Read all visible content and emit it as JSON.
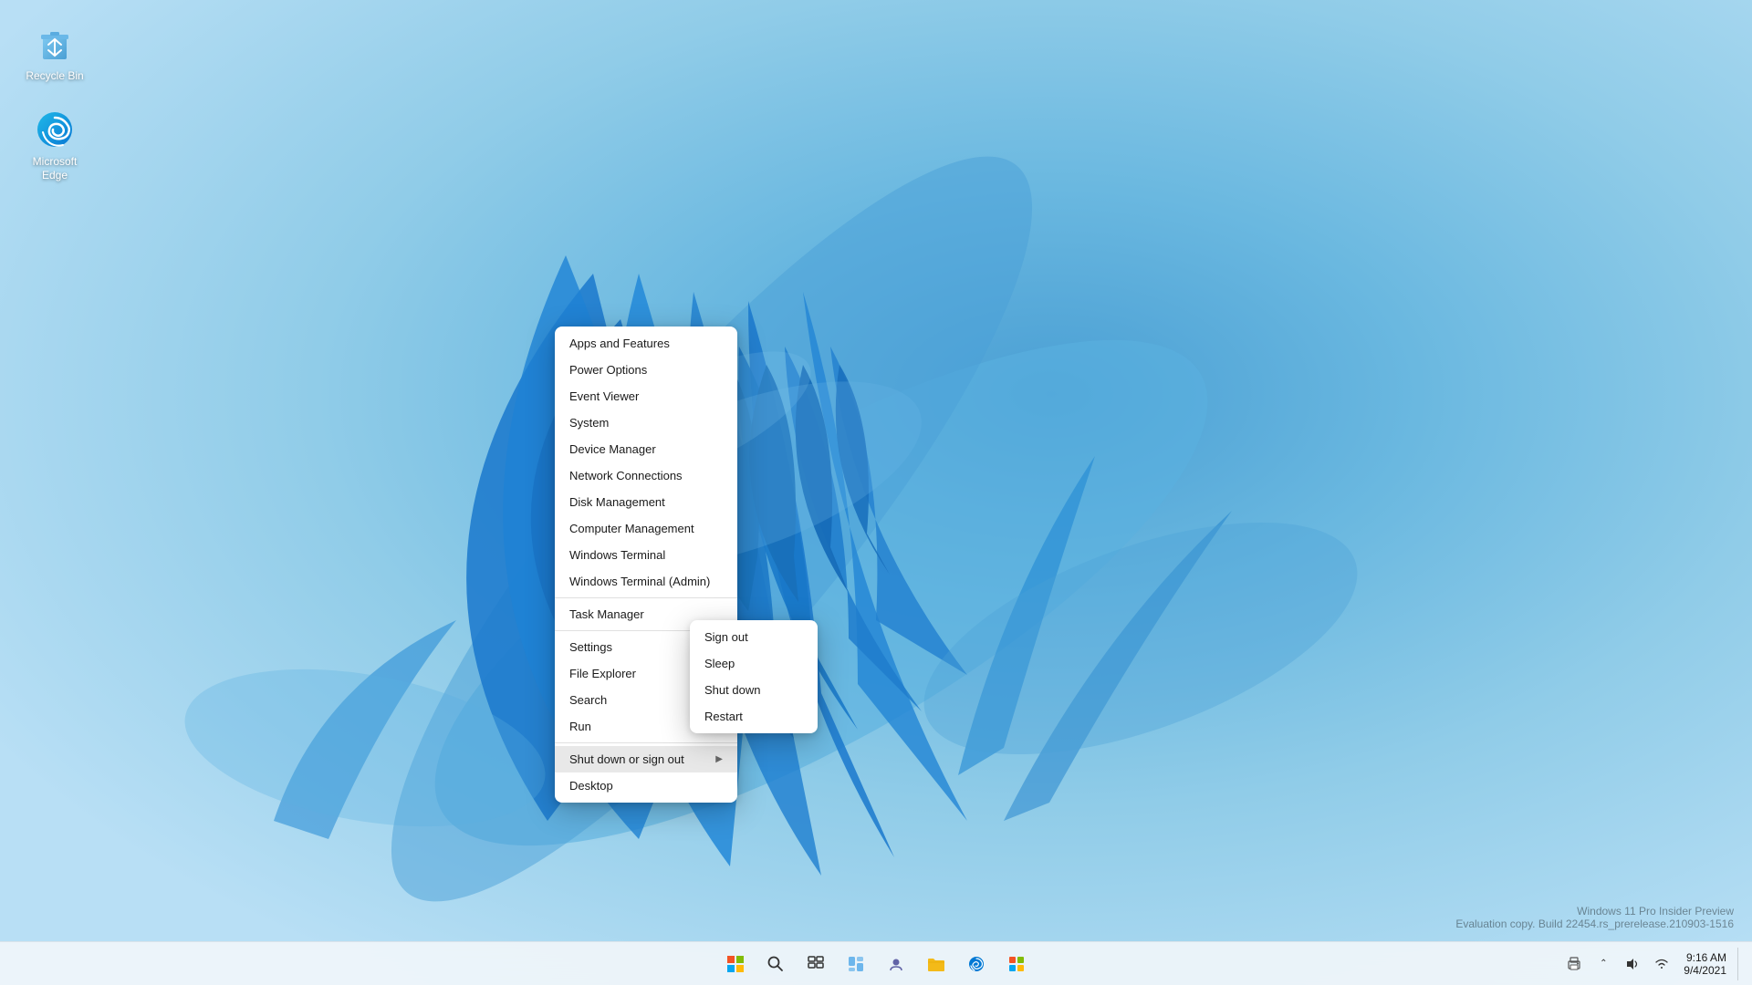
{
  "desktop": {
    "background_color": "#7ec8e8",
    "icons": [
      {
        "id": "recycle-bin",
        "label": "Recycle Bin",
        "icon": "recycle-bin"
      },
      {
        "id": "microsoft-edge",
        "label": "Microsoft Edge",
        "icon": "edge"
      }
    ]
  },
  "context_menu": {
    "items": [
      {
        "id": "apps-features",
        "label": "Apps and Features",
        "has_submenu": false
      },
      {
        "id": "power-options",
        "label": "Power Options",
        "has_submenu": false
      },
      {
        "id": "event-viewer",
        "label": "Event Viewer",
        "has_submenu": false
      },
      {
        "id": "system",
        "label": "System",
        "has_submenu": false
      },
      {
        "id": "device-manager",
        "label": "Device Manager",
        "has_submenu": false
      },
      {
        "id": "network-connections",
        "label": "Network Connections",
        "has_submenu": false
      },
      {
        "id": "disk-management",
        "label": "Disk Management",
        "has_submenu": false
      },
      {
        "id": "computer-management",
        "label": "Computer Management",
        "has_submenu": false
      },
      {
        "id": "windows-terminal",
        "label": "Windows Terminal",
        "has_submenu": false
      },
      {
        "id": "windows-terminal-admin",
        "label": "Windows Terminal (Admin)",
        "has_submenu": false
      },
      {
        "id": "task-manager",
        "label": "Task Manager",
        "has_submenu": false
      },
      {
        "id": "settings",
        "label": "Settings",
        "has_submenu": false
      },
      {
        "id": "file-explorer",
        "label": "File Explorer",
        "has_submenu": false
      },
      {
        "id": "search",
        "label": "Search",
        "has_submenu": false
      },
      {
        "id": "run",
        "label": "Run",
        "has_submenu": false
      },
      {
        "id": "shut-down-sign-out",
        "label": "Shut down or sign out",
        "has_submenu": true
      },
      {
        "id": "desktop",
        "label": "Desktop",
        "has_submenu": false
      }
    ]
  },
  "submenu": {
    "items": [
      {
        "id": "sign-out",
        "label": "Sign out"
      },
      {
        "id": "sleep",
        "label": "Sleep"
      },
      {
        "id": "shut-down",
        "label": "Shut down"
      },
      {
        "id": "restart",
        "label": "Restart"
      }
    ]
  },
  "taskbar": {
    "icons": [
      {
        "id": "start",
        "label": "Start",
        "unicode": "⊞"
      },
      {
        "id": "search",
        "label": "Search",
        "unicode": "🔍"
      },
      {
        "id": "task-view",
        "label": "Task View",
        "unicode": "⧉"
      },
      {
        "id": "widgets",
        "label": "Widgets",
        "unicode": "▦"
      },
      {
        "id": "chat",
        "label": "Chat",
        "unicode": "💬"
      },
      {
        "id": "file-explorer",
        "label": "File Explorer",
        "unicode": "📁"
      },
      {
        "id": "edge",
        "label": "Microsoft Edge",
        "unicode": "🌐"
      },
      {
        "id": "store",
        "label": "Microsoft Store",
        "unicode": "🛍"
      }
    ],
    "clock": {
      "time": "9:16 AM",
      "date": "9/4/2021"
    },
    "tray": {
      "icons": [
        "🖨",
        "🔊",
        "📶"
      ]
    }
  },
  "watermark": {
    "line1": "Windows 11 Pro Insider Preview",
    "line2": "Evaluation copy. Build 22454.rs_prerelease.210903-1516"
  }
}
